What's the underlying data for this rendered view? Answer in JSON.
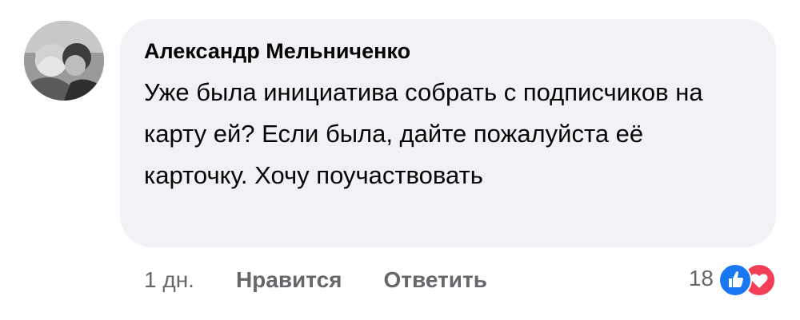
{
  "comment": {
    "author": "Александр Мельниченко",
    "text": "Уже была инициатива собрать с подписчиков на карту ей? Если была, дайте пожалуйста её карточку. Хочу поучаствовать",
    "timestamp": "1 дн.",
    "like_label": "Нравится",
    "reply_label": "Ответить",
    "reaction_count": "18",
    "reactions": [
      "like-icon",
      "love-icon"
    ],
    "colors": {
      "bubble": "#f0f2f5",
      "meta_text": "#65676b",
      "like": "#1877f2",
      "love": "#f33e58"
    }
  }
}
